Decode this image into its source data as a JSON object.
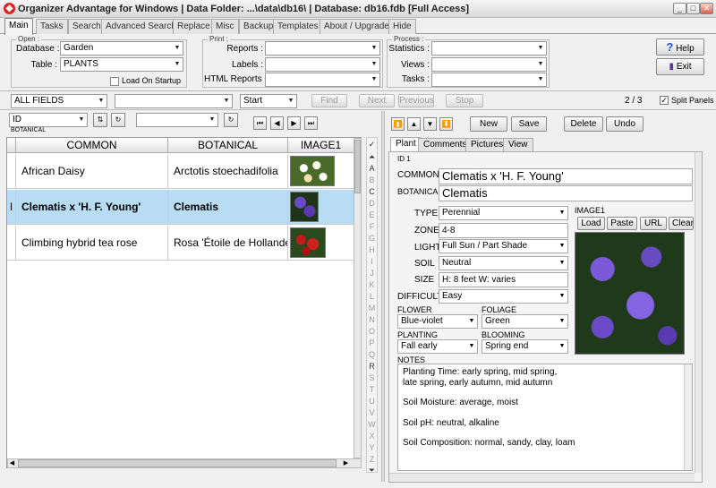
{
  "window": {
    "title": "Organizer Advantage for Windows | Data Folder: ...\\data\\db16\\ | Database: db16.fdb [Full Access]",
    "min": "_",
    "max": "□",
    "close": "✕"
  },
  "tabs": [
    "Main",
    "Tasks",
    "Search",
    "Advanced Search",
    "Replace",
    "Misc",
    "Backup",
    "Templates",
    "About / Upgrade",
    "Hide"
  ],
  "open": {
    "legend": "Open :",
    "database_label": "Database :",
    "database": "Garden",
    "table_label": "Table :",
    "table": "PLANTS",
    "load_on_startup": "Load On Startup"
  },
  "print": {
    "legend": "Print :",
    "reports_label": "Reports :",
    "labels_label": "Labels :",
    "html_label": "HTML Reports :"
  },
  "process": {
    "legend": "Process :",
    "statistics_label": "Statistics :",
    "views_label": "Views :",
    "tasks_label": "Tasks :"
  },
  "help": "Help",
  "exit": "Exit",
  "search": {
    "field": "ALL FIELDS",
    "start": "Start",
    "find": "Find",
    "next": "Next",
    "previous": "Previous",
    "stop": "Stop",
    "page": "2 / 3",
    "split_panels": "Split Panels"
  },
  "sort": {
    "field": "ID",
    "sub": "BOTANICAL"
  },
  "grid": {
    "headers": [
      "COMMON",
      "BOTANICAL",
      "IMAGE1"
    ],
    "rows": [
      {
        "common": "African Daisy",
        "botanical": "Arctotis stoechadifolia"
      },
      {
        "common": "Clematis x 'H. F. Young'",
        "botanical": "Clematis",
        "selected": true,
        "indicator": "I"
      },
      {
        "common": "Climbing hybrid tea rose",
        "botanical": "Rosa 'Étoile de Hollande'"
      }
    ]
  },
  "az": [
    "A",
    "B",
    "C",
    "D",
    "E",
    "F",
    "G",
    "H",
    "I",
    "J",
    "K",
    "L",
    "M",
    "N",
    "O",
    "P",
    "Q",
    "R",
    "S",
    "T",
    "U",
    "V",
    "W",
    "X",
    "Y",
    "Z"
  ],
  "record_buttons": {
    "new": "New",
    "save": "Save",
    "delete": "Delete",
    "undo": "Undo"
  },
  "panel_tabs": [
    "Plant",
    "Comments",
    "Pictures",
    "View"
  ],
  "record": {
    "id_label": "ID 1",
    "common_label": "COMMON",
    "common": "Clematis x 'H. F. Young'",
    "botanical_label": "BOTANICAL",
    "botanical": "Clematis",
    "type_label": "TYPE",
    "type": "Perennial",
    "zone_label": "ZONE",
    "zone": "4-8",
    "light_label": "LIGHT",
    "light": "Full Sun / Part Shade",
    "soil_label": "SOIL",
    "soil": "Neutral",
    "size_label": "SIZE",
    "size": "H: 8 feet  W: varies",
    "difficulty_label": "DIFFICULTY",
    "difficulty": "Easy",
    "flower_label": "FLOWER",
    "flower": "Blue-violet",
    "foliage_label": "FOLIAGE",
    "foliage": "Green",
    "planting_label": "PLANTING",
    "planting": "Fall early",
    "blooming_label": "BLOOMING",
    "blooming": "Spring end",
    "image_label": "IMAGE1",
    "notes_label": "NOTES",
    "notes": [
      "Planting Time:  early spring, mid spring,",
      "late spring, early autumn, mid autumn",
      "",
      "Soil Moisture:  average, moist",
      "",
      "Soil pH:  neutral, alkaline",
      "",
      "Soil Composition:  normal, sandy, clay, loam"
    ]
  },
  "image_buttons": {
    "load": "Load",
    "paste": "Paste",
    "url": "URL",
    "clear": "Clear"
  }
}
